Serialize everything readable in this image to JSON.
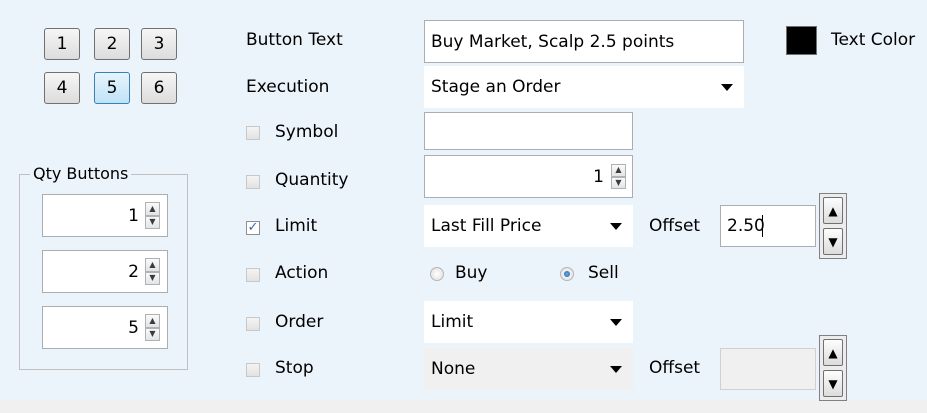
{
  "presets": {
    "buttons": [
      "1",
      "2",
      "3",
      "4",
      "5",
      "6"
    ],
    "selected": "5"
  },
  "qty_group": {
    "title": "Qty Buttons",
    "values": [
      "1",
      "2",
      "5"
    ]
  },
  "button_text": {
    "label": "Button Text",
    "value": "Buy Market, Scalp 2.5 points"
  },
  "text_color": {
    "label": "Text Color",
    "color": "#000000"
  },
  "execution": {
    "label": "Execution",
    "value": "Stage an Order"
  },
  "symbol": {
    "label": "Symbol",
    "checked": false,
    "value": ""
  },
  "quantity": {
    "label": "Quantity",
    "checked": false,
    "value": "1"
  },
  "limit": {
    "label": "Limit",
    "checked": true,
    "value": "Last Fill Price",
    "offset_label": "Offset",
    "offset_value": "2.50"
  },
  "action": {
    "label": "Action",
    "checked": false,
    "options": [
      "Buy",
      "Sell"
    ],
    "selected": "Sell"
  },
  "order": {
    "label": "Order",
    "checked": false,
    "value": "Limit"
  },
  "stop": {
    "label": "Stop",
    "checked": false,
    "value": "None",
    "offset_label": "Offset",
    "offset_value": ""
  },
  "colors": {
    "panel": "#ebf3fb",
    "active_button": "#bfe2f8",
    "check": "#3a63b4"
  }
}
